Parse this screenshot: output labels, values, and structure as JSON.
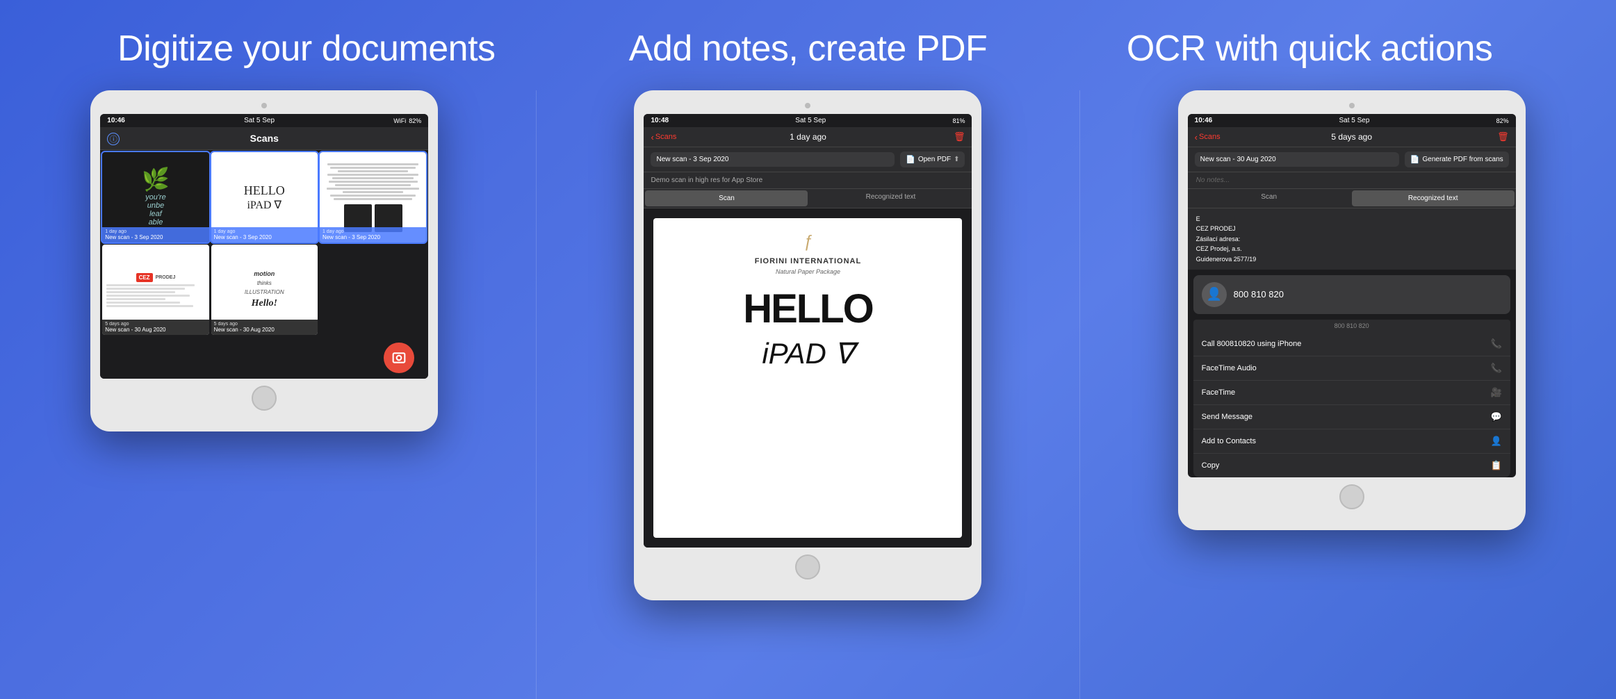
{
  "panels": [
    {
      "title": "Digitize your documents",
      "status_bar": {
        "time": "10:46",
        "date": "Sat 5 Sep",
        "signal": "▂▄▆",
        "wifi": "WiFi",
        "battery": "82%"
      },
      "screen_title": "Scans",
      "scans": [
        {
          "type": "plant",
          "time": "1 day ago",
          "name": "New scan - 3 Sep 2020",
          "selected": true
        },
        {
          "type": "hello",
          "time": "1 day ago",
          "name": "New scan - 3 Sep 2020",
          "selected": true
        },
        {
          "type": "text",
          "time": "1 day ago",
          "name": "New scan - 3 Sep 2020",
          "selected": true
        },
        {
          "type": "cez",
          "time": "5 days ago",
          "name": "New scan - 30 Aug 2020",
          "selected": false
        },
        {
          "type": "handwriting",
          "time": "5 days ago",
          "name": "New scan - 30 Aug 2020",
          "selected": false
        }
      ]
    },
    {
      "title": "Add notes, create PDF",
      "status_bar": {
        "time": "10:48",
        "date": "Sat 5 Sep",
        "battery": "81%"
      },
      "nav": {
        "back_label": "Scans",
        "title": "1 day ago"
      },
      "scan_name": "New scan - 3 Sep 2020",
      "open_pdf_label": "Open PDF",
      "notes_placeholder": "Demo scan in high res for App Store",
      "tab_scan": "Scan",
      "tab_recognized": "Recognized text",
      "doc": {
        "logo": "ƒ",
        "company": "FIORINI INTERNATIONAL",
        "subtitle": "Natural Paper Package",
        "hello": "HELLO",
        "ipad": "iPAD ∇"
      }
    },
    {
      "title": "OCR with quick actions",
      "status_bar": {
        "time": "10:46",
        "date": "Sat 5 Sep",
        "battery": "82%"
      },
      "nav": {
        "back_label": "Scans",
        "title": "5 days ago"
      },
      "scan_name": "New scan - 30 Aug 2020",
      "generate_pdf_label": "Generate PDF from scans",
      "no_notes": "No notes...",
      "tab_scan": "Scan",
      "tab_recognized": "Recognized text",
      "ocr_text": [
        "E",
        "CEZ PRODEJ",
        "Zásilací adresa:",
        "CEZ Prodej, a.s.",
        "Guidenerova 2577/19"
      ],
      "phone_number": "800 810 820",
      "phone_number_compact": "800 810 820",
      "actions": [
        {
          "label": "Call 800810820 using iPhone",
          "icon": "📞"
        },
        {
          "label": "FaceTime Audio",
          "icon": "📞"
        },
        {
          "label": "FaceTime",
          "icon": "🎥"
        },
        {
          "label": "Send Message",
          "icon": "💬"
        },
        {
          "label": "Add to Contacts",
          "icon": "👤"
        },
        {
          "label": "Copy",
          "icon": "📋"
        }
      ]
    }
  ]
}
